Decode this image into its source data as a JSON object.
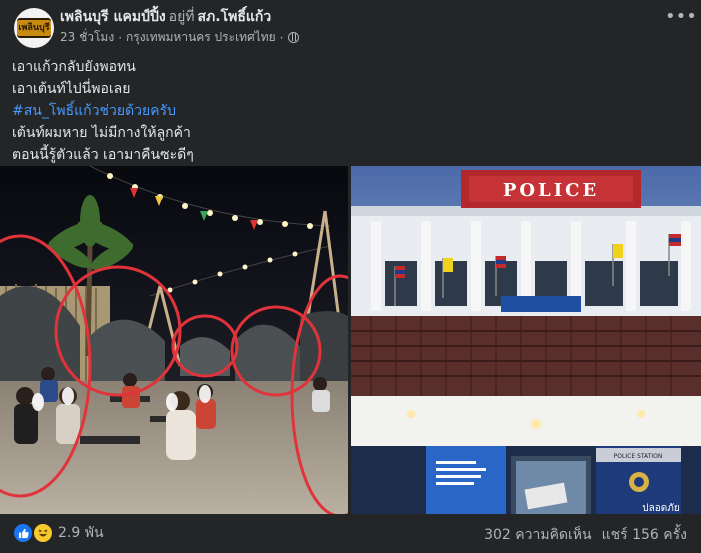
{
  "post": {
    "page_name": "เพลินบุรี แคมป์ปิ้ง",
    "at_word": "อยู่ที่",
    "location_name": "สภ.โพธิ์แก้ว",
    "time": "23 ชั่วโมง",
    "location_meta": "กรุงเทพมหานคร ประเทศไทย",
    "visibility_icon": "globe-icon",
    "more_icon": "more-options-icon",
    "avatar_text": "เพลินบุรี",
    "lines": [
      "เอาแก้วกลับยังพอทน",
      "เอาเต้นท์ไปนี่พอเลย",
      "#สน_โพธิ์แก้วช่วยด้วยครับ",
      "เต้นท์ผมหาย ไม่มีกางให้ลูกค้า",
      "ตอนนี้รู้ตัวแล้ว เอามาคืนซะดีๆ"
    ],
    "hashtag_color": "#4599ff"
  },
  "photo_right": {
    "sign": "POLICE",
    "small_sign": "POLICE STATION",
    "banner_text": "ปลอดภัย"
  },
  "footer": {
    "reaction_count": "2.9 พัน",
    "comments": "302 ความคิดเห็น",
    "shares": "แชร์ 156 ครั้ง",
    "reaction_icons": [
      "like-icon",
      "haha-icon"
    ]
  }
}
